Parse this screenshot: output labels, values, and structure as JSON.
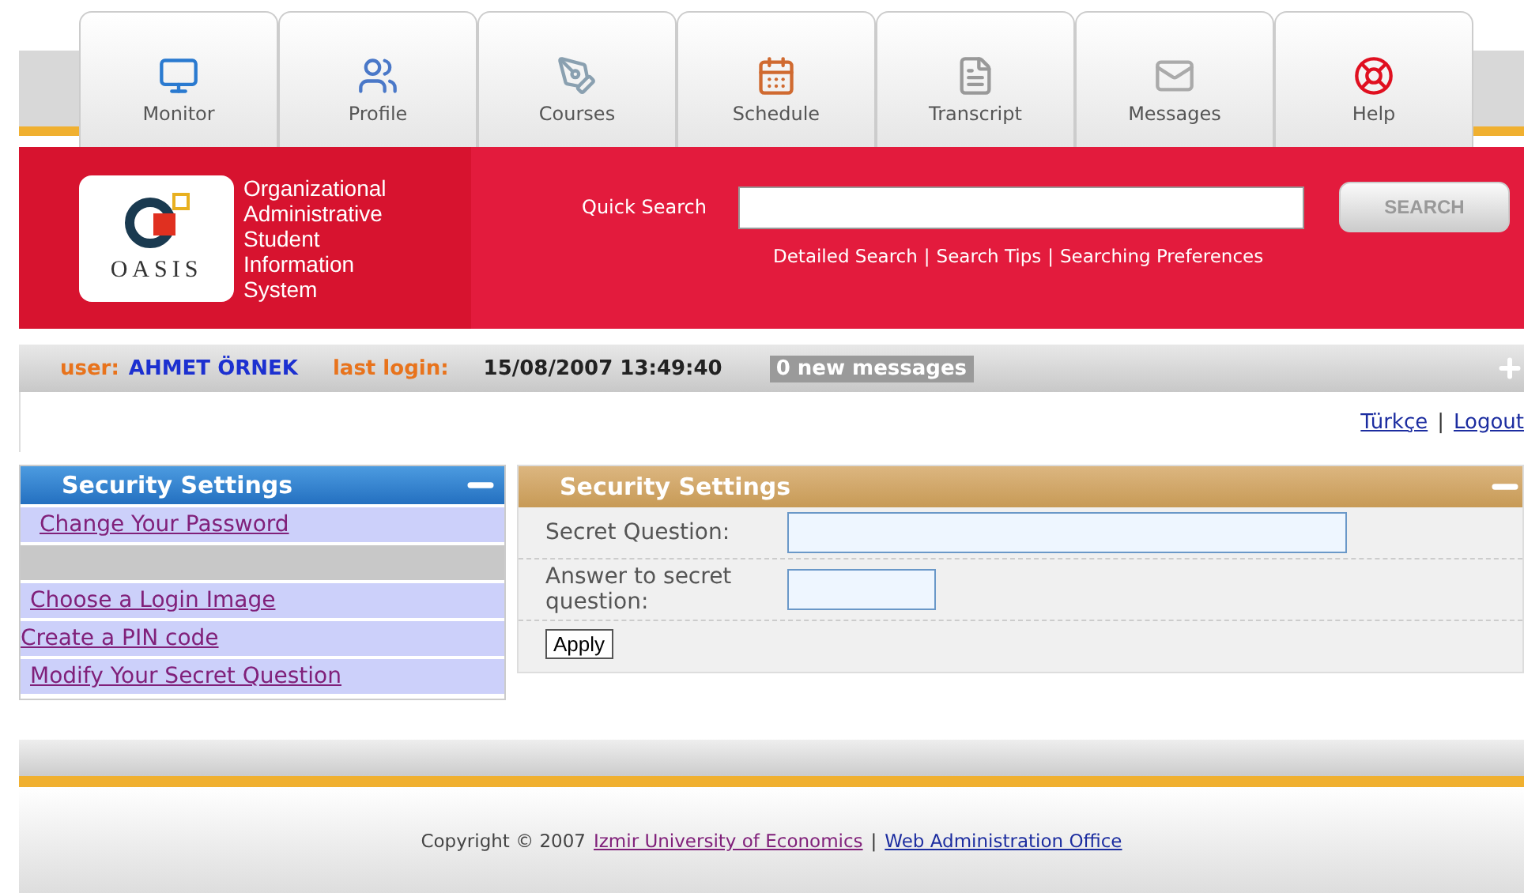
{
  "tabs": [
    {
      "label": "Monitor",
      "kind": "monitor"
    },
    {
      "label": "Profile",
      "kind": "profile"
    },
    {
      "label": "Courses",
      "kind": "courses"
    },
    {
      "label": "Schedule",
      "kind": "schedule"
    },
    {
      "label": "Transcript",
      "kind": "transcript"
    },
    {
      "label": "Messages",
      "kind": "messages"
    },
    {
      "label": "Help",
      "kind": "help"
    }
  ],
  "logo": {
    "mark": "OASIS",
    "lines": [
      "Organizational",
      "Administrative",
      "Student",
      "Information",
      "System"
    ]
  },
  "search": {
    "label": "Quick Search",
    "button": "SEARCH",
    "links": [
      "Detailed Search",
      "Search Tips",
      "Searching Preferences"
    ],
    "separator": "|"
  },
  "user_bar": {
    "user_label": "user:",
    "user_name": "AHMET ÖRNEK",
    "login_label": "last login:",
    "login_time": "15/08/2007 13:49:40",
    "messages": "0 new messages"
  },
  "top_links": {
    "items": [
      "Türkçe",
      "Logout"
    ],
    "separator": "|"
  },
  "sidebar": {
    "title": "Security Settings",
    "items": [
      {
        "label": "Change Your Password",
        "visited": true
      },
      {
        "kind": "separator"
      },
      {
        "label": "Choose a Login Image",
        "visited": true
      },
      {
        "label": "Create a PIN code",
        "visited": true
      },
      {
        "label": "Modify Your Secret Question",
        "visited": true
      }
    ]
  },
  "panel": {
    "title": "Security Settings",
    "fields": [
      {
        "label": "Secret Question:",
        "wide": true
      },
      {
        "label": "Answer to secret question:",
        "wide": false
      }
    ],
    "button": "Apply"
  },
  "footer": {
    "copyright": "Copyright © 2007",
    "links": [
      {
        "label": "Izmir University of Economics",
        "visited": true
      },
      {
        "label": "Web Administration Office",
        "visited": false
      }
    ],
    "separator": "|"
  }
}
